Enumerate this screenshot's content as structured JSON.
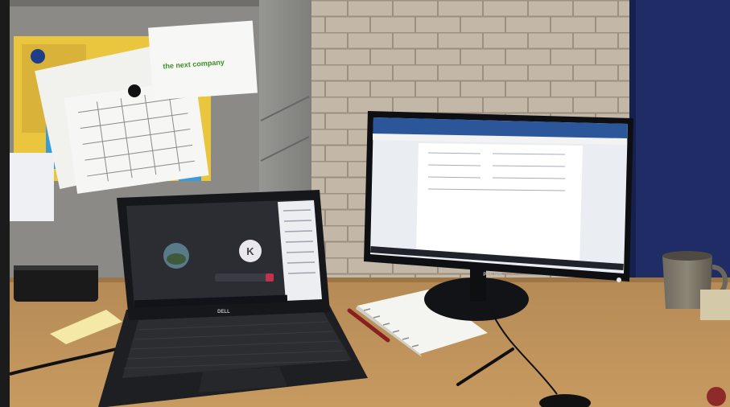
{
  "scene": {
    "notice_board": {
      "company_text": "the next company"
    },
    "laptop": {
      "brand": "DELL",
      "screen": {
        "participant_initial": "K"
      }
    },
    "monitor": {
      "brand": "PHILIPS"
    }
  }
}
